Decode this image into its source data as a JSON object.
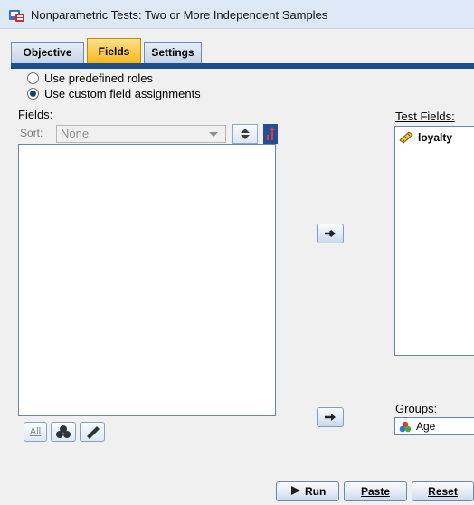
{
  "window": {
    "title": "Nonparametric Tests: Two or More Independent Samples"
  },
  "tabs": [
    {
      "label": "Objective",
      "active": false
    },
    {
      "label": "Fields",
      "active": true
    },
    {
      "label": "Settings",
      "active": false
    }
  ],
  "roles": {
    "predefined": {
      "label": "Use predefined roles",
      "checked": false
    },
    "custom": {
      "label": "Use custom field assignments",
      "checked": true
    }
  },
  "fields": {
    "label": "Fields:",
    "sort_label": "Sort:",
    "sort_value": "None",
    "items": []
  },
  "test_fields": {
    "label": "Test Fields:",
    "items": [
      {
        "name": "loyalty",
        "icon": "scale-ruler-icon"
      }
    ]
  },
  "groups": {
    "label": "Groups:",
    "value": "Age",
    "icon": "nominal-circles-icon"
  },
  "bottom_buttons": {
    "all_label": "All"
  },
  "actions": {
    "run": "Run",
    "paste": "Paste",
    "reset": "Reset"
  },
  "colors": {
    "active_tab": "#f7b81d",
    "tab_strip": "#1d4f8e",
    "list_border": "#6b83a6"
  }
}
